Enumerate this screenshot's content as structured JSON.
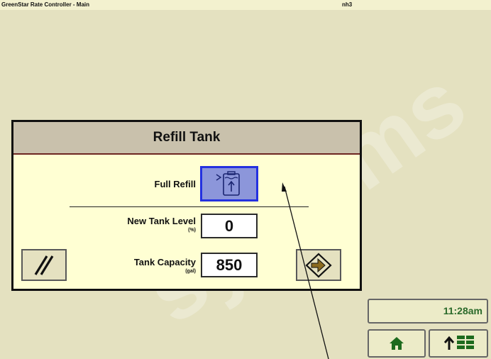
{
  "topbar": {
    "title": "GreenStar Rate Controller - Main",
    "mode": "nh3"
  },
  "dialog": {
    "title": "Refill Tank",
    "full_refill_label": "Full Refill",
    "new_tank_level_label": "New Tank Level",
    "new_tank_level_unit": "(%)",
    "new_tank_level_value": "0",
    "tank_capacity_label": "Tank Capacity",
    "tank_capacity_unit": "(gal)",
    "tank_capacity_value": "850",
    "icons": {
      "full_refill": "tank-refill-icon",
      "cancel": "cancel-slash-icon",
      "enter": "enter-arrow-icon"
    }
  },
  "status": {
    "time": "11:28am"
  },
  "nav": {
    "home_icon": "home-icon",
    "menu_icon": "up-menu-icon"
  },
  "colors": {
    "background": "#e4e1c0",
    "dialog_background": "#ffffd3",
    "header_background": "#c9c1ac",
    "selected_button": "#8c96da",
    "selected_border": "#2431e0",
    "accent_green": "#2e7a2e"
  }
}
